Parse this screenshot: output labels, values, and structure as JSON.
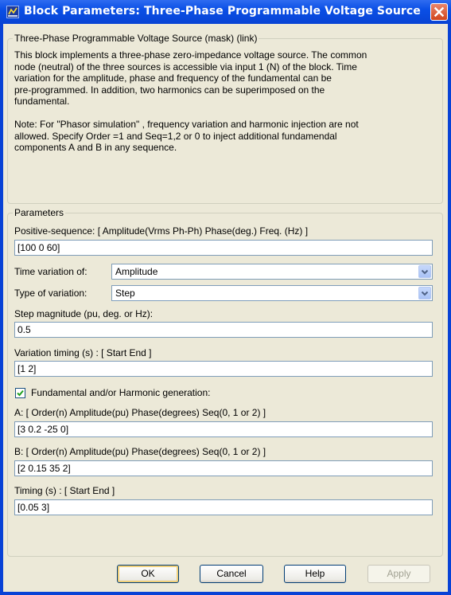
{
  "window": {
    "title": "Block Parameters: Three-Phase Programmable Voltage Source"
  },
  "description_group": {
    "legend": "Three-Phase Programmable Voltage Source (mask) (link)",
    "lines": [
      "This block implements a three-phase zero-impedance voltage source. The common",
      "node (neutral) of the three sources is accessible via input 1 (N) of the block. Time",
      "variation for the amplitude, phase and frequency of the fundamental can be",
      "pre-programmed. In addition, two harmonics can be superimposed on the",
      "fundamental.",
      "",
      "Note: For  \"Phasor simulation\" , frequency variation and harmonic injection are not",
      "allowed.  Specify  Order =1 and Seq=1,2 or 0 to inject additional fundamendal",
      "components A and B in  any sequence."
    ]
  },
  "parameters": {
    "legend": "Parameters",
    "positive_sequence": {
      "label": "Positive-sequence: [ Amplitude(Vrms Ph-Ph)  Phase(deg.)  Freq. (Hz) ]",
      "value": "[100  0 60]"
    },
    "time_variation": {
      "label": "Time variation of:",
      "value": "Amplitude"
    },
    "variation_type": {
      "label": "Type of variation:",
      "value": "Step"
    },
    "step_magnitude": {
      "label": "Step magnitude (pu, deg. or Hz):",
      "value": "0.5"
    },
    "variation_timing": {
      "label": "Variation timing (s) : [ Start   End ]",
      "value": "[1 2]"
    },
    "harmonic_generation": {
      "label": "Fundamental and/or Harmonic generation:",
      "checked": true
    },
    "harmonic_a": {
      "label": "A:  [ Order(n)  Amplitude(pu) Phase(degrees)  Seq(0, 1 or 2) ]",
      "value": "[3 0.2 -25 0]"
    },
    "harmonic_b": {
      "label": "B:  [ Order(n)  Amplitude(pu) Phase(degrees)  Seq(0, 1 or 2) ]",
      "value": "[2 0.15 35 2]"
    },
    "timing": {
      "label": "Timing (s) : [ Start   End ]",
      "value": "[0.05  3]"
    }
  },
  "buttons": {
    "ok": "OK",
    "cancel": "Cancel",
    "help": "Help",
    "apply": "Apply"
  },
  "icons": {
    "app": "simulink-block-icon",
    "close": "close-icon",
    "dropdown": "chevron-down-icon",
    "check": "checkmark-icon"
  },
  "colors": {
    "titlebar": "#0a4fe6",
    "dialog_bg": "#ece9d8",
    "close_button": "#d2451c",
    "input_border": "#7f9db9"
  }
}
